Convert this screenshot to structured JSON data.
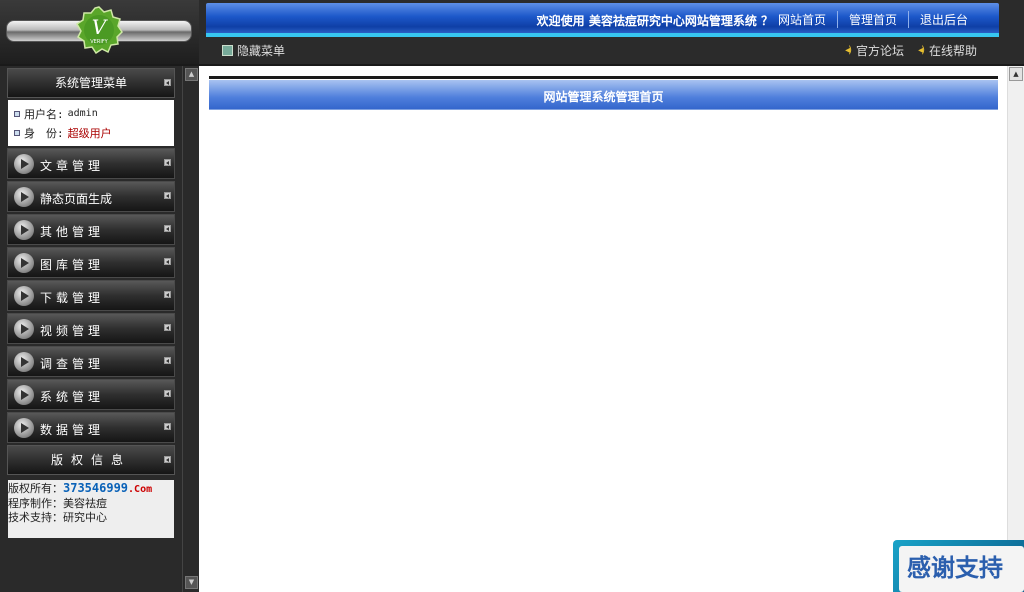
{
  "header": {
    "logo_letter": "V",
    "logo_caption": "VERIFY",
    "welcome": "欢迎使用 美容祛痘研究中心网站管理系统 ？",
    "links": [
      "网站首页",
      "管理首页",
      "退出后台"
    ],
    "hide_menu": "隐藏菜单",
    "sub_links": [
      "官方论坛",
      "在线帮助"
    ]
  },
  "sidebar": {
    "title": "系统管理菜单",
    "user": {
      "name_label": "用户名:",
      "name_value": "admin",
      "role_label": "身　份:",
      "role_value": "超级用户"
    },
    "items": [
      {
        "label": "文章管理"
      },
      {
        "label": "静态页面生成"
      },
      {
        "label": "其他管理"
      },
      {
        "label": "图库管理"
      },
      {
        "label": "下载管理"
      },
      {
        "label": "视频管理"
      },
      {
        "label": "调查管理"
      },
      {
        "label": "系统管理"
      },
      {
        "label": "数据管理"
      }
    ],
    "copyright_head": "版权信息",
    "copyright": {
      "owner_label": "版权所有：",
      "owner_brand": "373546999",
      "owner_suffix": ".Com",
      "maker": "程序制作：美容祛痘",
      "support": "技术支持：研究中心"
    }
  },
  "main": {
    "title": "网站管理系统管理首页"
  },
  "thanks_badge": "感谢支持"
}
